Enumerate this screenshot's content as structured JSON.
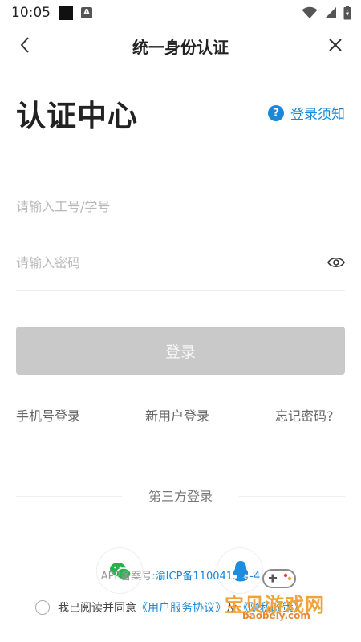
{
  "status_bar": {
    "time": "10:05"
  },
  "nav": {
    "title": "统一身份认证"
  },
  "hero": {
    "title": "认证中心"
  },
  "notice": {
    "icon_glyph": "?",
    "label": "登录须知"
  },
  "form": {
    "username_placeholder": "请输入工号/学号",
    "password_placeholder": "请输入密码",
    "login_label": "登录"
  },
  "links": {
    "phone_login": "手机号登录",
    "new_user": "新用户登录",
    "forgot": "忘记密码?"
  },
  "third_party": {
    "title": "第三方登录",
    "providers": [
      "wechat-icon",
      "qq-icon"
    ]
  },
  "icp": {
    "prefix": "APP备案号:",
    "number": "渝ICP备1100415号-4"
  },
  "agreement": {
    "prefix": "我已阅读并同意",
    "service": "《用户服务协议》",
    "conj": "及",
    "privacy": "《隐私政策》"
  },
  "watermark": {
    "text": "宝贝游戏网",
    "url": "baobely.com"
  },
  "colors": {
    "accent": "#1a88d8",
    "button_disabled": "#c9c9c9",
    "watermark": "#f0a33a"
  }
}
